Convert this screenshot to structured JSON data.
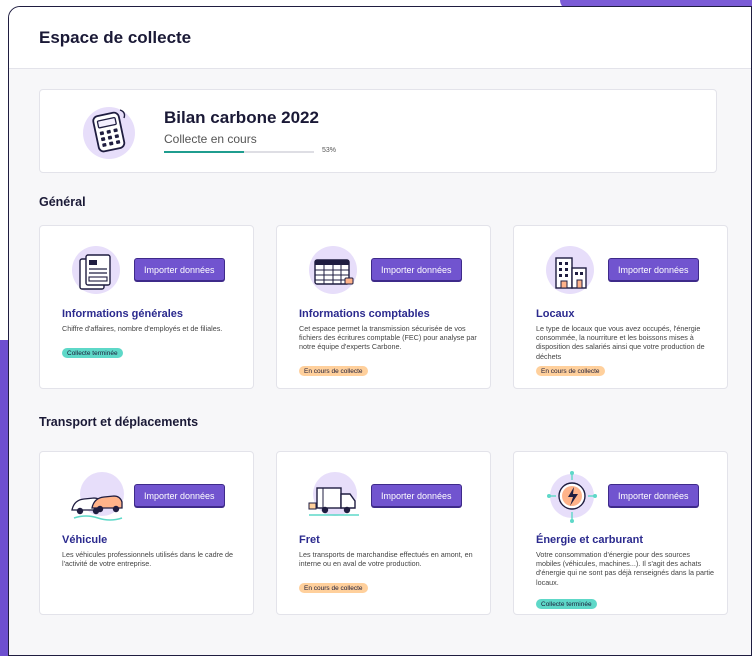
{
  "header": {
    "title": "Espace de collecte"
  },
  "bilan": {
    "title": "Bilan carbone 2022",
    "status": "Collecte en cours",
    "progress": 53,
    "progress_label": "53%"
  },
  "sections": [
    {
      "title": "Général"
    },
    {
      "title": "Transport et déplacements"
    }
  ],
  "cards": [
    {
      "title": "Informations générales",
      "description": "Chiffre d'affaires, nombre d'employés et de filiales.",
      "button": "Importer données",
      "badge": "Collecte terminée"
    },
    {
      "title": "Informations comptables",
      "description": "Cet espace permet la transmission sécurisée de vos fichiers des écritures comptable (FEC) pour analyse par notre équipe d'experts Carbone.",
      "button": "Importer données",
      "badge": "En cours de collecte"
    },
    {
      "title": "Locaux",
      "description": "Le type de locaux que vous avez occupés, l'énergie consommée, la nourriture et les boissons mises à disposition des salariés ainsi que votre production de déchets",
      "button": "Importer données",
      "badge": "En cours de collecte"
    },
    {
      "title": "Véhicule",
      "description": "Les véhicules professionnels utilisés dans le cadre de l'activité de votre entreprise.",
      "button": "Importer données",
      "badge": ""
    },
    {
      "title": "Fret",
      "description": "Les transports de marchandise effectués en amont, en interne ou en aval de votre production.",
      "button": "Importer données",
      "badge": "En cours de collecte"
    },
    {
      "title": "Énergie et carburant",
      "description": "Votre consommation d'énergie pour des sources mobiles (véhicules, machines...). Il s'agit des achats d'énergie qui ne sont pas déjà renseignés dans la partie locaux.",
      "button": "Importer données",
      "badge": "Collecte terminée"
    }
  ],
  "colors": {
    "accent": "#7154cf",
    "progress": "#1f9d8f",
    "done_badge": "#5ed8c8",
    "progress_badge": "#ffd09c",
    "title": "#2b2a8e"
  },
  "icons": [
    "calculator-icon",
    "documents-icon",
    "spreadsheet-icon",
    "building-icon",
    "cars-icon",
    "truck-icon",
    "energy-icon"
  ]
}
